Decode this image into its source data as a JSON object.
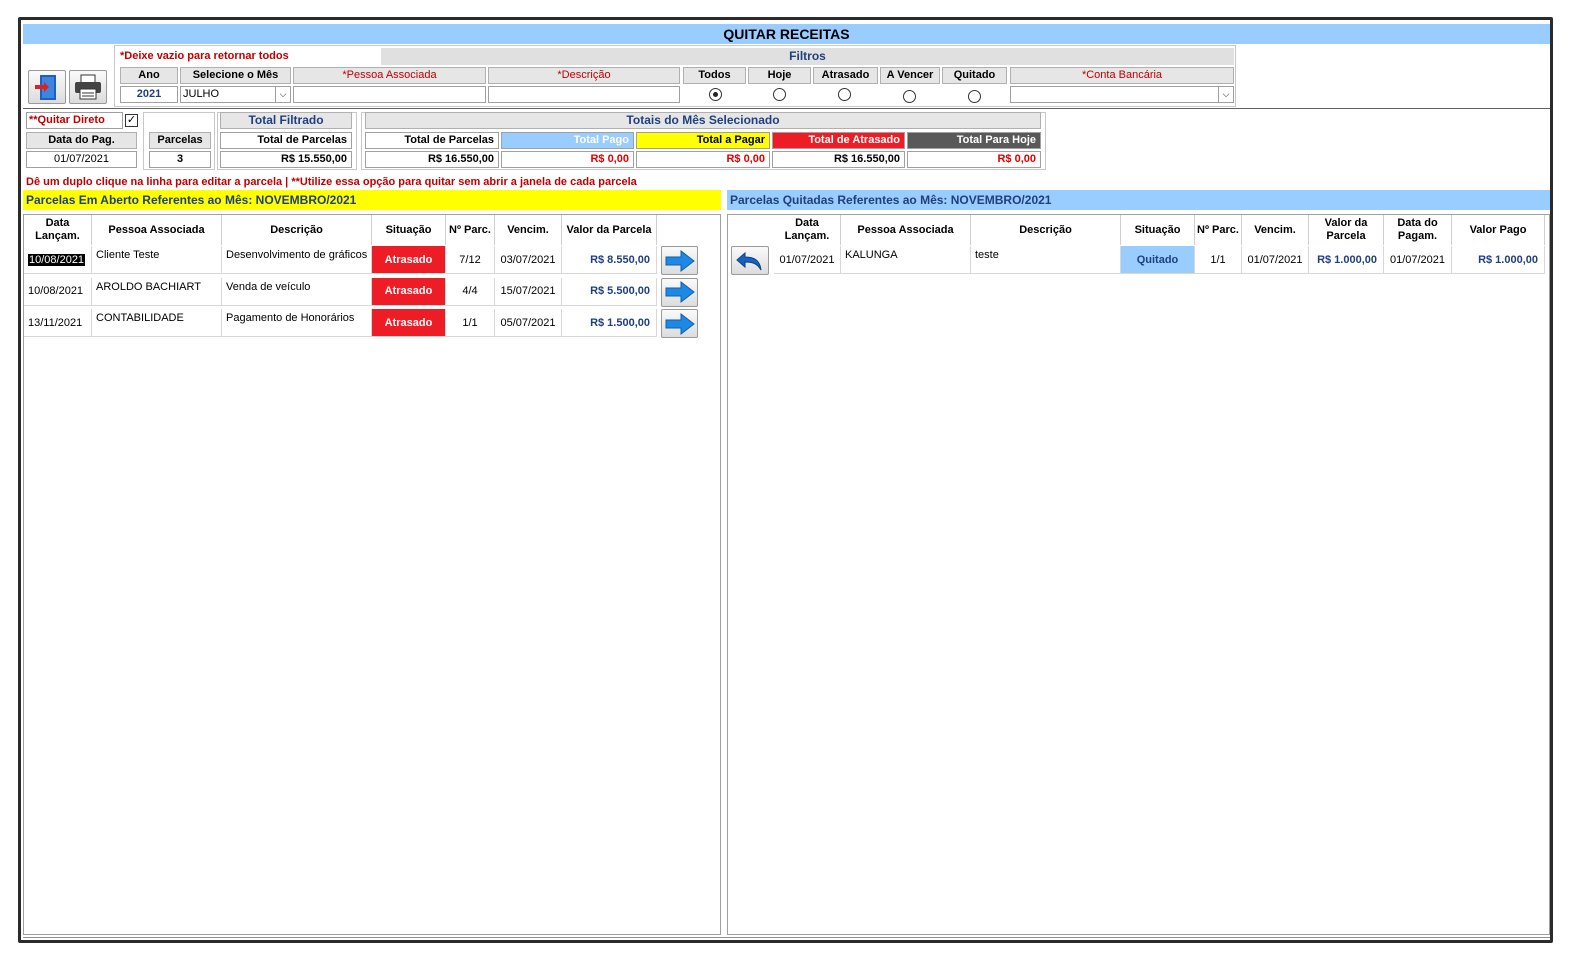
{
  "title": "QUITAR RECEITAS",
  "filters": {
    "hint": "*Deixe vazio para retornar todos",
    "group_label": "Filtros",
    "ano_label": "Ano",
    "ano_value": "2021",
    "mes_label": "Selecione o Mês",
    "mes_value": "JULHO",
    "pessoa_label": "*Pessoa Associada",
    "pessoa_value": "",
    "descricao_label": "*Descrição",
    "descricao_value": "",
    "radios": [
      {
        "label": "Todos",
        "checked": true
      },
      {
        "label": "Hoje",
        "checked": false
      },
      {
        "label": "Atrasado",
        "checked": false
      },
      {
        "label": "A Vencer",
        "checked": false
      },
      {
        "label": "Quitado",
        "checked": false
      }
    ],
    "conta_label": "*Conta Bancária",
    "conta_value": ""
  },
  "quick": {
    "quitar_direto_label": "**Quitar Direto",
    "quitar_direto_checked": true,
    "data_pag_label": "Data do Pag.",
    "data_pag_value": "01/07/2021",
    "parcelas_label": "Parcelas",
    "parcelas_value": "3"
  },
  "total_filtrado": {
    "title": "Total Filtrado",
    "label": "Total de Parcelas",
    "value": "R$ 15.550,00"
  },
  "totais_mes": {
    "title": "Totais do Mês Selecionado",
    "cols": [
      {
        "label": "Total de Parcelas",
        "value": "R$ 16.550,00",
        "bg": "#ffffff",
        "fg": "#000000",
        "vfg": "#000000"
      },
      {
        "label": "Total Pago",
        "value": "R$ 0,00",
        "bg": "#99ccff",
        "fg": "#ffffff",
        "vfg": "#e00000"
      },
      {
        "label": "Total a Pagar",
        "value": "R$ 0,00",
        "bg": "#ffff00",
        "fg": "#000000",
        "vfg": "#e00000"
      },
      {
        "label": "Total de Atrasado",
        "value": "R$ 16.550,00",
        "bg": "#ee1c25",
        "fg": "#ffffff",
        "vfg": "#000000"
      },
      {
        "label": "Total Para Hoje",
        "value": "R$ 0,00",
        "bg": "#595959",
        "fg": "#ffffff",
        "vfg": "#e00000"
      }
    ]
  },
  "instruction": "Dê um duplo clique na linha para editar a parcela | **Utilize essa opção para quitar sem abrir a janela de cada parcela",
  "open_section": {
    "title": "Parcelas Em Aberto Referentes ao Mês: NOVEMBRO/2021",
    "headers": [
      "Data Lançam.",
      "Pessoa Associada",
      "Descrição",
      "Situação",
      "Nº Parc.",
      "Vencim.",
      "Valor da Parcela"
    ],
    "rows": [
      {
        "data": "10/08/2021",
        "pessoa": "Cliente Teste",
        "descricao": "Desenvolvimento de gráficos",
        "situacao": "Atrasado",
        "parc": "7/12",
        "vencim": "03/07/2021",
        "valor": "R$ 8.550,00"
      },
      {
        "data": "10/08/2021",
        "pessoa": "AROLDO BACHIART",
        "descricao": "Venda de veículo",
        "situacao": "Atrasado",
        "parc": "4/4",
        "vencim": "15/07/2021",
        "valor": "R$ 5.500,00"
      },
      {
        "data": "13/11/2021",
        "pessoa": "CONTABILIDADE",
        "descricao": "Pagamento de Honorários",
        "situacao": "Atrasado",
        "parc": "1/1",
        "vencim": "05/07/2021",
        "valor": "R$ 1.500,00"
      }
    ]
  },
  "paid_section": {
    "title": "Parcelas Quitadas Referentes ao Mês: NOVEMBRO/2021",
    "headers": [
      "Data Lançam.",
      "Pessoa Associada",
      "Descrição",
      "Situação",
      "Nº Parc.",
      "Vencim.",
      "Valor da Parcela",
      "Data do Pagam.",
      "Valor Pago"
    ],
    "rows": [
      {
        "data": "01/07/2021",
        "pessoa": "KALUNGA",
        "descricao": "teste",
        "situacao": "Quitado",
        "parc": "1/1",
        "vencim": "01/07/2021",
        "valor": "R$ 1.000,00",
        "data_pag": "01/07/2021",
        "valor_pago": "R$ 1.000,00"
      }
    ]
  }
}
